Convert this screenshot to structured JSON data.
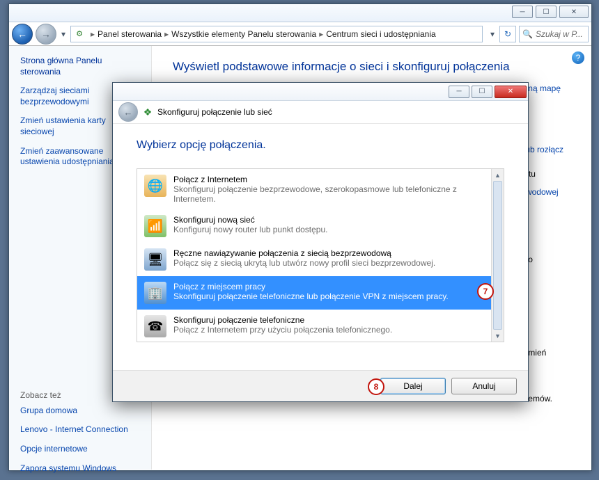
{
  "main_window": {
    "buttons": {
      "min": "─",
      "max": "☐",
      "close": "✕"
    },
    "breadcrumb": {
      "seg1": "Panel sterowania",
      "seg2": "Wszystkie elementy Panelu sterowania",
      "seg3": "Centrum sieci i udostępniania"
    },
    "search_placeholder": "Szukaj w P...",
    "heading": "Wyświetl podstawowe informacje o sieci i skonfiguruj połączenia",
    "right_links": {
      "l1": "pełną mapę",
      "l2": "z lub rozłącz",
      "l3a": "metu",
      "l3b": "zewodowej",
      "l4": "albo",
      "l5": "e zmień",
      "l6": "oblemów."
    }
  },
  "sidebar": {
    "heading": "Strona główna Panelu sterowania",
    "link1": "Zarządzaj sieciami bezprzewodowymi",
    "link2": "Zmień ustawienia karty sieciowej",
    "link3": "Zmień zaawansowane ustawienia udostępniania",
    "see_also": "Zobacz też",
    "sa1": "Grupa domowa",
    "sa2": "Lenovo - Internet Connection",
    "sa3": "Opcje internetowe",
    "sa4": "Zapora systemu Windows"
  },
  "dialog": {
    "buttons": {
      "min": "─",
      "max": "☐",
      "close": "✕"
    },
    "bar_title": "Skonfiguruj połączenie lub sieć",
    "heading": "Wybierz opcję połączenia.",
    "options": [
      {
        "title": "Połącz z Internetem",
        "desc": "Skonfiguruj połączenie bezprzewodowe, szerokopasmowe lub telefoniczne z Internetem."
      },
      {
        "title": "Skonfiguruj nową sieć",
        "desc": "Konfiguruj nowy router lub punkt dostępu."
      },
      {
        "title": "Ręczne nawiązywanie połączenia z siecią bezprzewodową",
        "desc": "Połącz się z siecią ukrytą lub utwórz nowy profil sieci bezprzewodowej."
      },
      {
        "title": "Połącz z miejscem pracy",
        "desc": "Skonfiguruj połączenie telefoniczne lub połączenie VPN z miejscem pracy."
      },
      {
        "title": "Skonfiguruj połączenie telefoniczne",
        "desc": "Połącz z Internetem przy użyciu połączenia telefonicznego."
      }
    ],
    "next": "Dalej",
    "cancel": "Anuluj",
    "badge7": "7",
    "badge8": "8"
  }
}
